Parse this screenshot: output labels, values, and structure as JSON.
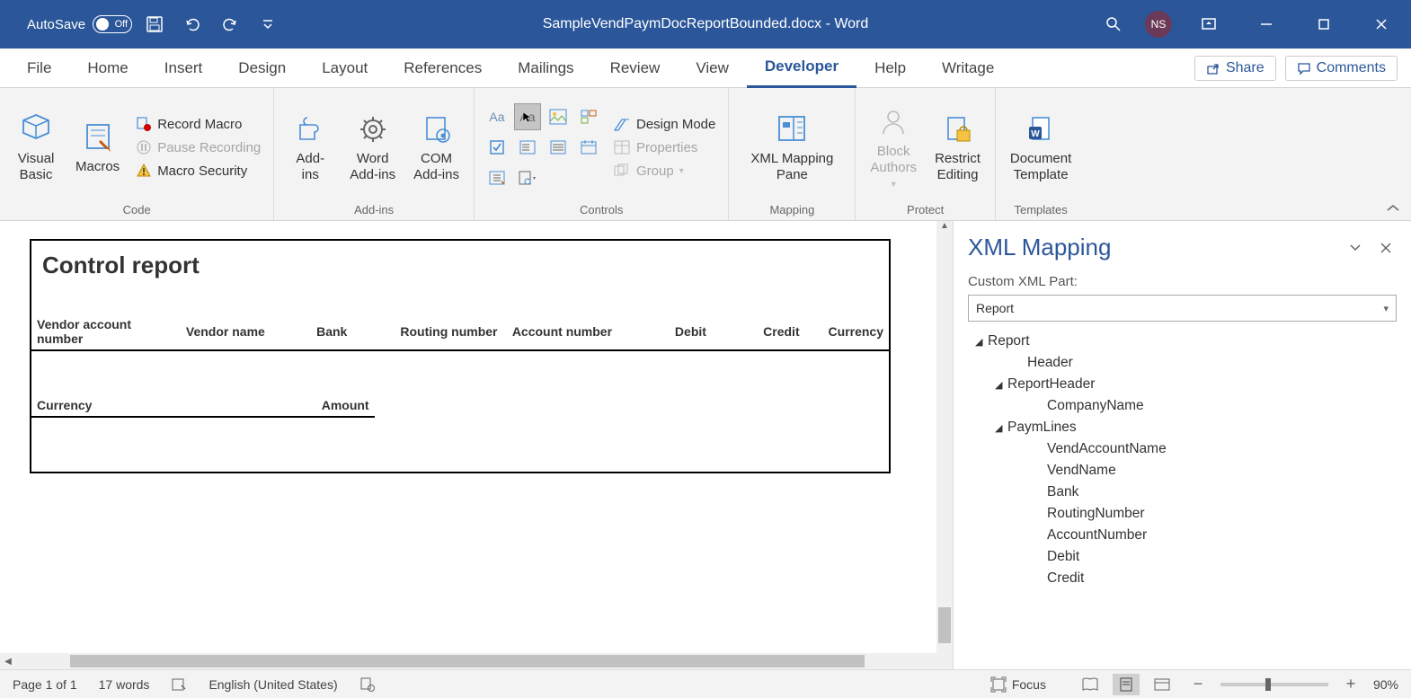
{
  "titlebar": {
    "autosave_label": "AutoSave",
    "autosave_state": "Off",
    "doc_title": "SampleVendPaymDocReportBounded.docx - Word",
    "user_initials": "NS"
  },
  "tabs": {
    "file": "File",
    "home": "Home",
    "insert": "Insert",
    "design": "Design",
    "layout": "Layout",
    "references": "References",
    "mailings": "Mailings",
    "review": "Review",
    "view": "View",
    "developer": "Developer",
    "help": "Help",
    "writage": "Writage",
    "share": "Share",
    "comments": "Comments"
  },
  "ribbon": {
    "code": {
      "visual_basic": "Visual\nBasic",
      "macros": "Macros",
      "record_macro": "Record Macro",
      "pause_recording": "Pause Recording",
      "macro_security": "Macro Security",
      "label": "Code"
    },
    "addins": {
      "addins": "Add-\nins",
      "word_addins": "Word\nAdd-ins",
      "com_addins": "COM\nAdd-ins",
      "label": "Add-ins"
    },
    "controls": {
      "design_mode": "Design Mode",
      "properties": "Properties",
      "group": "Group",
      "label": "Controls"
    },
    "mapping": {
      "xml_mapping_pane": "XML Mapping\nPane",
      "label": "Mapping"
    },
    "protect": {
      "block_authors": "Block\nAuthors",
      "restrict_editing": "Restrict\nEditing",
      "label": "Protect"
    },
    "templates": {
      "document_template": "Document\nTemplate",
      "label": "Templates"
    }
  },
  "document": {
    "report_title": "Control report",
    "columns1": {
      "c0": "Vendor account number",
      "c1": "Vendor name",
      "c2": "Bank",
      "c3": "Routing number",
      "c4": "Account number",
      "c5": "Debit",
      "c6": "Credit",
      "c7": "Currency"
    },
    "columns2": {
      "c0": "Currency",
      "c1": "Amount"
    }
  },
  "pane": {
    "title": "XML Mapping",
    "part_label": "Custom XML Part:",
    "selected_part": "Report",
    "tree": {
      "n0": "Report",
      "n1": "Header",
      "n2": "ReportHeader",
      "n3": "CompanyName",
      "n4": "PaymLines",
      "n5": "VendAccountName",
      "n6": "VendName",
      "n7": "Bank",
      "n8": "RoutingNumber",
      "n9": "AccountNumber",
      "n10": "Debit",
      "n11": "Credit"
    }
  },
  "statusbar": {
    "page": "Page 1 of 1",
    "words": "17 words",
    "language": "English (United States)",
    "focus": "Focus",
    "zoom": "90%"
  }
}
